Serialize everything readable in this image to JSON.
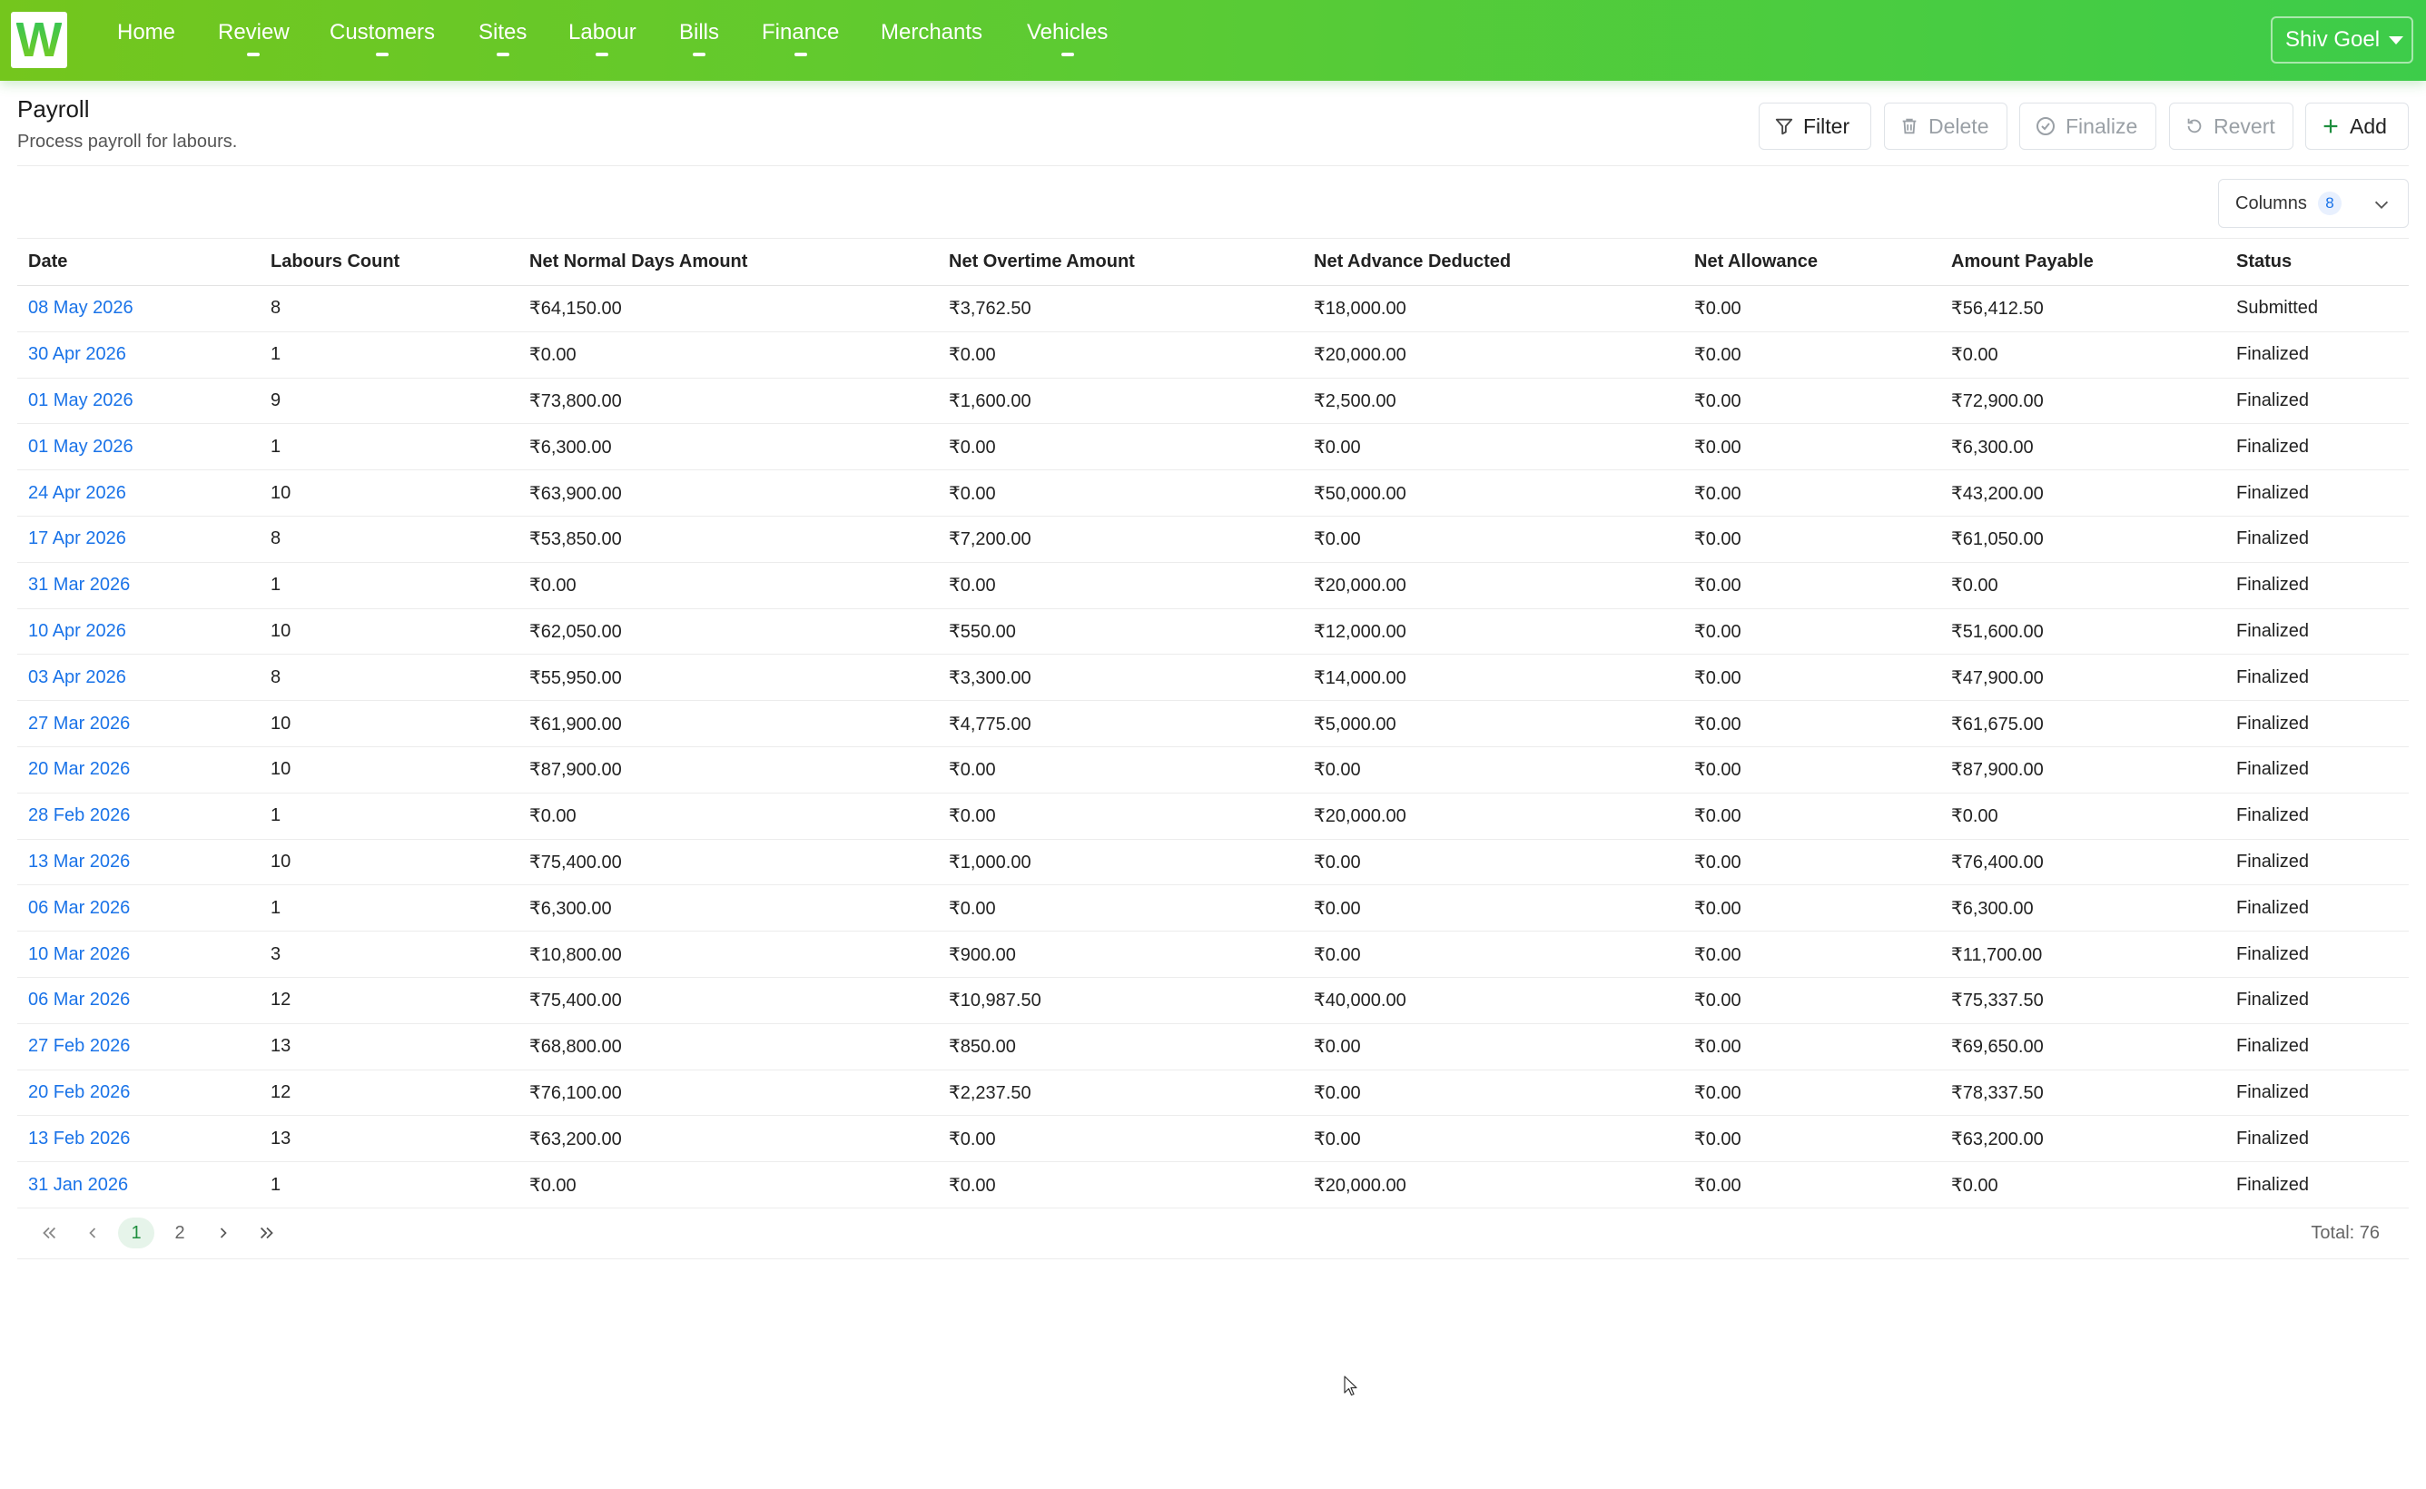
{
  "app": {
    "logo_letter": "W",
    "brand_color": "#4ccb3f"
  },
  "nav": {
    "items": [
      {
        "label": "Home",
        "has_menu": false
      },
      {
        "label": "Review",
        "has_menu": true
      },
      {
        "label": "Customers",
        "has_menu": true
      },
      {
        "label": "Sites",
        "has_menu": true
      },
      {
        "label": "Labour",
        "has_menu": true
      },
      {
        "label": "Bills",
        "has_menu": true
      },
      {
        "label": "Finance",
        "has_menu": true
      },
      {
        "label": "Merchants",
        "has_menu": false
      },
      {
        "label": "Vehicles",
        "has_menu": true
      }
    ],
    "user": "Shiv Goel"
  },
  "page": {
    "title": "Payroll",
    "subtitle": "Process payroll for labours."
  },
  "toolbar": {
    "filter": "Filter",
    "delete": "Delete",
    "finalize": "Finalize",
    "revert": "Revert",
    "add": "Add"
  },
  "columns_control": {
    "label": "Columns",
    "count": "8"
  },
  "table": {
    "headers": [
      "Date",
      "Labours Count",
      "Net Normal Days Amount",
      "Net Overtime Amount",
      "Net Advance Deducted",
      "Net Allowance",
      "Amount Payable",
      "Status"
    ],
    "rows": [
      [
        "08 May 2026",
        "8",
        "₹64,150.00",
        "₹3,762.50",
        "₹18,000.00",
        "₹0.00",
        "₹56,412.50",
        "Submitted"
      ],
      [
        "30 Apr 2026",
        "1",
        "₹0.00",
        "₹0.00",
        "₹20,000.00",
        "₹0.00",
        "₹0.00",
        "Finalized"
      ],
      [
        "01 May 2026",
        "9",
        "₹73,800.00",
        "₹1,600.00",
        "₹2,500.00",
        "₹0.00",
        "₹72,900.00",
        "Finalized"
      ],
      [
        "01 May 2026",
        "1",
        "₹6,300.00",
        "₹0.00",
        "₹0.00",
        "₹0.00",
        "₹6,300.00",
        "Finalized"
      ],
      [
        "24 Apr 2026",
        "10",
        "₹63,900.00",
        "₹0.00",
        "₹50,000.00",
        "₹0.00",
        "₹43,200.00",
        "Finalized"
      ],
      [
        "17 Apr 2026",
        "8",
        "₹53,850.00",
        "₹7,200.00",
        "₹0.00",
        "₹0.00",
        "₹61,050.00",
        "Finalized"
      ],
      [
        "31 Mar 2026",
        "1",
        "₹0.00",
        "₹0.00",
        "₹20,000.00",
        "₹0.00",
        "₹0.00",
        "Finalized"
      ],
      [
        "10 Apr 2026",
        "10",
        "₹62,050.00",
        "₹550.00",
        "₹12,000.00",
        "₹0.00",
        "₹51,600.00",
        "Finalized"
      ],
      [
        "03 Apr 2026",
        "8",
        "₹55,950.00",
        "₹3,300.00",
        "₹14,000.00",
        "₹0.00",
        "₹47,900.00",
        "Finalized"
      ],
      [
        "27 Mar 2026",
        "10",
        "₹61,900.00",
        "₹4,775.00",
        "₹5,000.00",
        "₹0.00",
        "₹61,675.00",
        "Finalized"
      ],
      [
        "20 Mar 2026",
        "10",
        "₹87,900.00",
        "₹0.00",
        "₹0.00",
        "₹0.00",
        "₹87,900.00",
        "Finalized"
      ],
      [
        "28 Feb 2026",
        "1",
        "₹0.00",
        "₹0.00",
        "₹20,000.00",
        "₹0.00",
        "₹0.00",
        "Finalized"
      ],
      [
        "13 Mar 2026",
        "10",
        "₹75,400.00",
        "₹1,000.00",
        "₹0.00",
        "₹0.00",
        "₹76,400.00",
        "Finalized"
      ],
      [
        "06 Mar 2026",
        "1",
        "₹6,300.00",
        "₹0.00",
        "₹0.00",
        "₹0.00",
        "₹6,300.00",
        "Finalized"
      ],
      [
        "10 Mar 2026",
        "3",
        "₹10,800.00",
        "₹900.00",
        "₹0.00",
        "₹0.00",
        "₹11,700.00",
        "Finalized"
      ],
      [
        "06 Mar 2026",
        "12",
        "₹75,400.00",
        "₹10,987.50",
        "₹40,000.00",
        "₹0.00",
        "₹75,337.50",
        "Finalized"
      ],
      [
        "27 Feb 2026",
        "13",
        "₹68,800.00",
        "₹850.00",
        "₹0.00",
        "₹0.00",
        "₹69,650.00",
        "Finalized"
      ],
      [
        "20 Feb 2026",
        "12",
        "₹76,100.00",
        "₹2,237.50",
        "₹0.00",
        "₹0.00",
        "₹78,337.50",
        "Finalized"
      ],
      [
        "13 Feb 2026",
        "13",
        "₹63,200.00",
        "₹0.00",
        "₹0.00",
        "₹0.00",
        "₹63,200.00",
        "Finalized"
      ],
      [
        "31 Jan 2026",
        "1",
        "₹0.00",
        "₹0.00",
        "₹20,000.00",
        "₹0.00",
        "₹0.00",
        "Finalized"
      ]
    ]
  },
  "pagination": {
    "pages": [
      "1",
      "2"
    ],
    "current": "1",
    "total_label": "Total: 76"
  }
}
